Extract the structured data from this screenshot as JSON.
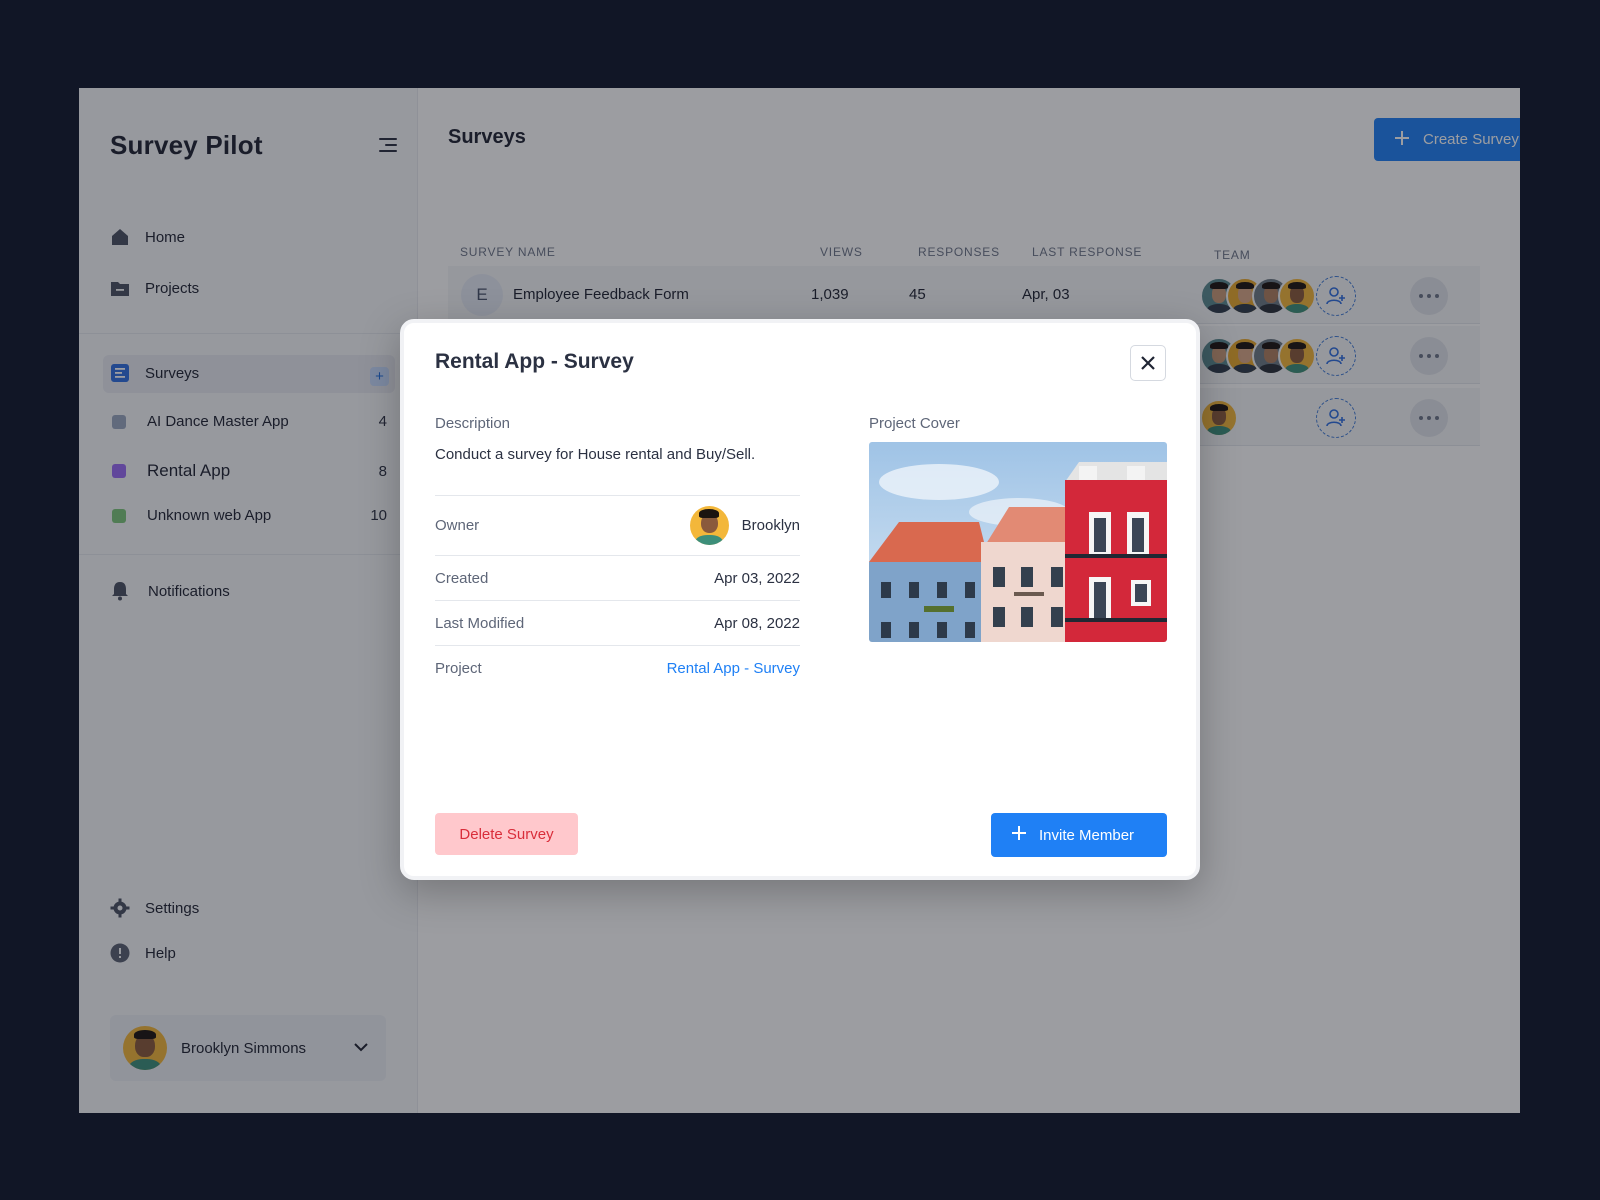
{
  "sidebar": {
    "brand": "Survey Pilot",
    "nav": {
      "home": "Home",
      "projects": "Projects",
      "surveys": "Surveys",
      "notifications": "Notifications",
      "settings": "Settings",
      "help": "Help"
    },
    "projects": [
      {
        "label": "AI Dance Master App",
        "count": "4",
        "color": "#9aa8c0"
      },
      {
        "label": "Rental App",
        "count": "8",
        "color": "#9a6cf5"
      },
      {
        "label": "Unknown web App",
        "count": "10",
        "color": "#7cc77a"
      }
    ],
    "user": {
      "name": "Brooklyn Simmons"
    }
  },
  "main": {
    "title": "Surveys",
    "create_label": "Create Survey",
    "columns": {
      "name": "SURVEY NAME",
      "views": "VIEWS",
      "responses": "RESPONSES",
      "last_response": "LAST RESPONSE",
      "team": "TEAM"
    },
    "rows": [
      {
        "initial": "E",
        "name": "Employee Feedback Form",
        "views": "1,039",
        "responses": "45",
        "last_response": "Apr, 03"
      }
    ]
  },
  "modal": {
    "title": "Rental App - Survey",
    "description_label": "Description",
    "description": "Conduct a survey for House rental and Buy/Sell.",
    "owner_label": "Owner",
    "owner": "Brooklyn",
    "created_label": "Created",
    "created": "Apr 03, 2022",
    "modified_label": "Last Modified",
    "modified": "Apr 08, 2022",
    "project_label": "Project",
    "project": "Rental App - Survey",
    "cover_label": "Project Cover",
    "delete_label": "Delete Survey",
    "invite_label": "Invite Member"
  },
  "colors": {
    "accent": "#1f80f5",
    "danger": "#d92d3a",
    "danger_bg": "#ffc8cc",
    "backdrop": "#111626"
  },
  "icons": [
    "menu-icon",
    "home-icon",
    "folder-icon",
    "survey-icon",
    "bell-icon",
    "gear-icon",
    "help-icon",
    "chevron-down-icon",
    "plus-icon",
    "add-user-icon",
    "more-icon",
    "close-icon"
  ]
}
